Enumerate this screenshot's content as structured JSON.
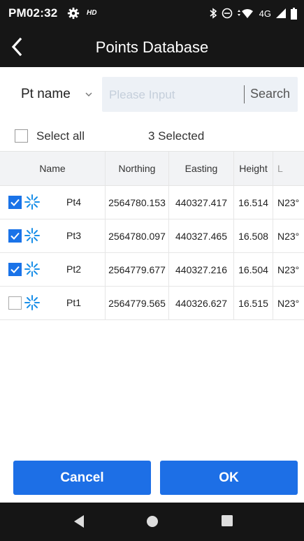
{
  "status_bar": {
    "time": "PM02:32",
    "hd": "HD",
    "network": "4G"
  },
  "header": {
    "title": "Points Database"
  },
  "search": {
    "field_selector": "Pt name",
    "placeholder": "Please Input",
    "value": "",
    "button_label": "Search"
  },
  "selection": {
    "select_all_label": "Select all",
    "selected_count_text": "3 Selected"
  },
  "table": {
    "columns": [
      "Name",
      "Northing",
      "Easting",
      "Height",
      "L"
    ],
    "rows": [
      {
        "checked": true,
        "name": "Pt4",
        "northing": "2564780.153",
        "easting": "440327.417",
        "height": "16.514",
        "lat": "N23°"
      },
      {
        "checked": true,
        "name": "Pt3",
        "northing": "2564780.097",
        "easting": "440327.465",
        "height": "16.508",
        "lat": "N23°"
      },
      {
        "checked": true,
        "name": "Pt2",
        "northing": "2564779.677",
        "easting": "440327.216",
        "height": "16.504",
        "lat": "N23°"
      },
      {
        "checked": false,
        "name": "Pt1",
        "northing": "2564779.565",
        "easting": "440326.627",
        "height": "16.515",
        "lat": "N23°"
      }
    ]
  },
  "actions": {
    "cancel_label": "Cancel",
    "ok_label": "OK"
  },
  "colors": {
    "accent": "#1d6fe6",
    "dark_bar": "#161616",
    "point_icon": "#1a8fe8"
  }
}
